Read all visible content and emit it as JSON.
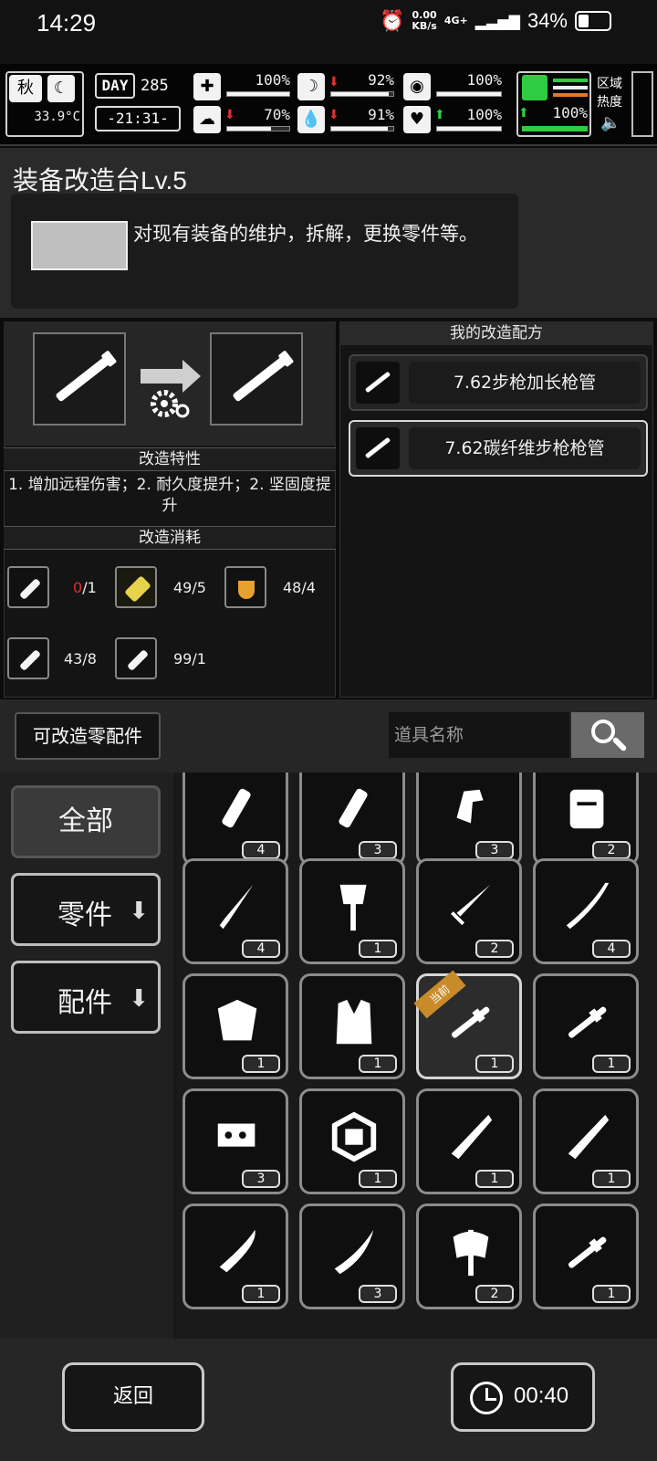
{
  "status_bar": {
    "time": "14:29",
    "net_speed": "0.00",
    "net_unit": "KB/s",
    "network": "4G+",
    "battery": "34%"
  },
  "hud": {
    "season": "秋",
    "temperature": "33.9°C",
    "day_label": "DAY",
    "day": "285",
    "clock": "-21:31-",
    "zone_heat": "区域热度",
    "stats": {
      "health": "100%",
      "hunger": "92%",
      "thirst": "91%",
      "sanity": "70%",
      "stamina": "100%",
      "mood": "100%",
      "leg": "100%"
    },
    "bars": {
      "health": 1.0,
      "hunger": 0.92,
      "thirst": 0.91,
      "sanity": 0.7,
      "stamina": 1.0,
      "mood": 1.0,
      "leg": 1.0
    }
  },
  "station": {
    "title": "装备改造台Lv.5",
    "description": "对现有装备的维护，拆解，更换零件等。"
  },
  "modify": {
    "traits_header": "改造特性",
    "traits": "1. 增加远程伤害；2. 耐久度提升；2. 坚固度提升",
    "cost_header": "改造消耗",
    "costs": [
      {
        "have": "0",
        "need": "/1",
        "icon": "barrel-icon"
      },
      {
        "have": "49/5",
        "need": "",
        "icon": "gold-bar-icon"
      },
      {
        "have": "48/4",
        "need": "",
        "icon": "flask-icon"
      },
      {
        "have": "43/8",
        "need": "",
        "icon": "oil-can-icon"
      },
      {
        "have": "99/1",
        "need": "",
        "icon": "tool-icon"
      }
    ]
  },
  "recipes": {
    "header": "我的改造配方",
    "items": [
      {
        "name": "7.62步枪加长枪管"
      },
      {
        "name": "7.62碳纤维步枪枪管"
      }
    ]
  },
  "search": {
    "category_button": "可改造零配件",
    "placeholder": "道具名称"
  },
  "categories": [
    {
      "label": "全部"
    },
    {
      "label": "零件"
    },
    {
      "label": "配件"
    }
  ],
  "inventory": {
    "current_tag": "当前",
    "items": [
      {
        "icon": "tube-icon",
        "count": "4"
      },
      {
        "icon": "tube-icon",
        "count": "3"
      },
      {
        "icon": "trigger-icon",
        "count": "3"
      },
      {
        "icon": "backpack-icon",
        "count": "2"
      },
      {
        "icon": "knife-icon",
        "count": "4"
      },
      {
        "icon": "axe-icon",
        "count": "1"
      },
      {
        "icon": "sword-icon",
        "count": "2"
      },
      {
        "icon": "katana-icon",
        "count": "4"
      },
      {
        "icon": "armor-icon",
        "count": "1"
      },
      {
        "icon": "vest-icon",
        "count": "1"
      },
      {
        "icon": "barrel-icon",
        "count": "1"
      },
      {
        "icon": "barrel-icon",
        "count": "1"
      },
      {
        "icon": "trigger-group-icon",
        "count": "3"
      },
      {
        "icon": "weight-icon",
        "count": "1"
      },
      {
        "icon": "serrated-blade-icon",
        "count": "1"
      },
      {
        "icon": "serrated-blade-icon",
        "count": "1"
      },
      {
        "icon": "machete-icon",
        "count": "1"
      },
      {
        "icon": "kukri-icon",
        "count": "3"
      },
      {
        "icon": "battle-axe-icon",
        "count": "2"
      },
      {
        "icon": "barrel-icon",
        "count": "1"
      }
    ]
  },
  "footer": {
    "back": "返回",
    "timer": "00:40"
  }
}
